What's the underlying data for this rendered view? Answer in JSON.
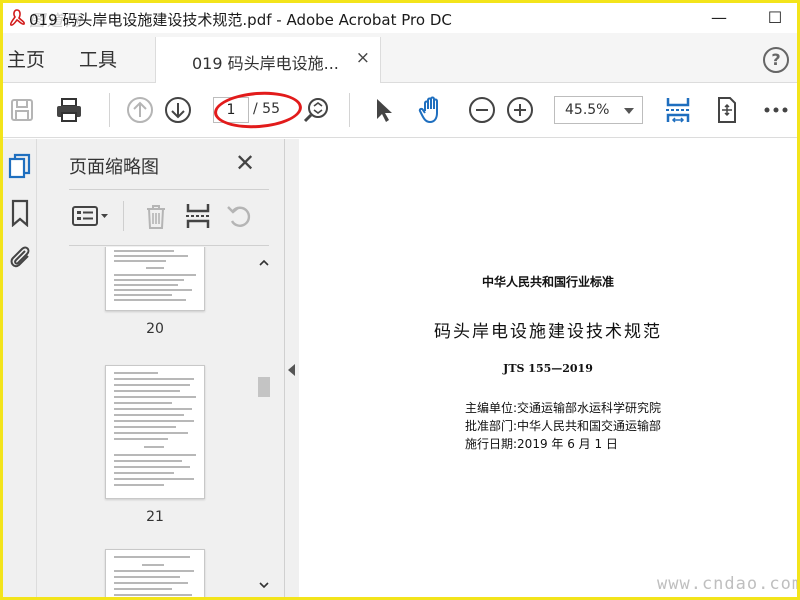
{
  "window": {
    "title": "019 码头岸电设施建设技术规范.pdf - Adobe Acrobat Pro DC",
    "logo_watermark": "图道网",
    "minimize_glyph": "—",
    "maximize_glyph": "☐"
  },
  "nav": {
    "home_label": "主页",
    "tools_label": "工具",
    "doc_tab_label": "019 码头岸电设施...",
    "doc_tab_close": "×",
    "help_label": "?"
  },
  "toolbar": {
    "page_current": "1",
    "page_total": "/ 55",
    "zoom_value": "45.5%",
    "icons": [
      "save-icon",
      "print-icon",
      "page-up-icon",
      "page-down-icon",
      "zoom-search-icon",
      "select-arrow-icon",
      "hand-icon",
      "zoom-out-icon",
      "zoom-in-icon",
      "fit-page-icon",
      "rotate-view-icon",
      "more-icon"
    ]
  },
  "thumbnails": {
    "title": "页面缩略图",
    "close_glyph": "✕",
    "pages": [
      {
        "label": "20"
      },
      {
        "label": "21"
      }
    ]
  },
  "document": {
    "standard_line": "中华人民共和国行业标准",
    "title": "码头岸电设施建设技术规范",
    "code": "JTS 155—2019",
    "editor": "主编单位:交通运输部水运科学研究院",
    "approver": "批准部门:中华人民共和国交通运输部",
    "effective": "施行日期:2019 年 6 月 1 日"
  },
  "watermark": {
    "site": "www.cndao.com"
  },
  "colors": {
    "accent_blue": "#1f6fbf",
    "annotation_red": "#e21b1b",
    "frame_yellow": "#f3e41b"
  }
}
